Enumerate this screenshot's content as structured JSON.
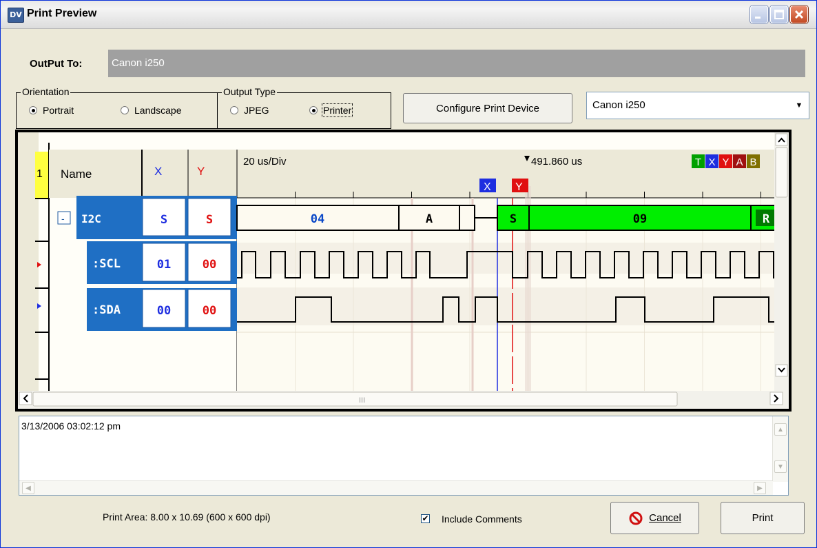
{
  "window": {
    "title": "Print Preview",
    "icon": "app-icon"
  },
  "output": {
    "label": "OutPut To:",
    "value": "Canon i250"
  },
  "orientation": {
    "title": "Orientation",
    "options": [
      {
        "label": "Portrait",
        "selected": true
      },
      {
        "label": "Landscape",
        "selected": false
      }
    ]
  },
  "output_type": {
    "title": "Output Type",
    "options": [
      {
        "label": "JPEG",
        "selected": false
      },
      {
        "label": "Printer",
        "selected": true
      }
    ]
  },
  "configure_button": "Configure Print Device",
  "printer_select": {
    "value": "Canon i250"
  },
  "waveform": {
    "row_number": "1",
    "columns": {
      "name": "Name",
      "x": "X",
      "y": "Y"
    },
    "timebase": "20 us/Div",
    "time_marker": "491.860 us",
    "badges": [
      {
        "label": "T",
        "color": "#00a000"
      },
      {
        "label": "X",
        "color": "#1e2ee0"
      },
      {
        "label": "Y",
        "color": "#e01010"
      },
      {
        "label": "A",
        "color": "#a01010"
      },
      {
        "label": "B",
        "color": "#807000"
      }
    ],
    "cursor_x_label": "X",
    "cursor_y_label": "Y",
    "expand_symbol": "-",
    "channels": [
      {
        "name": "I2C",
        "x": "S",
        "y": "S"
      },
      {
        "name": ":SCL",
        "x": "01",
        "y": "00"
      },
      {
        "name": ":SDA",
        "x": "00",
        "y": "00"
      }
    ],
    "bus_segments": [
      {
        "label": "04",
        "color": "#fdfaf0",
        "text_color": "#0a48c8"
      },
      {
        "label": "A",
        "color": "#fdfaf0",
        "text_color": "#000000"
      },
      {
        "label": "S",
        "color": "#00ee00",
        "text_color": "#000000"
      },
      {
        "label": "09",
        "color": "#00ee00",
        "text_color": "#000000"
      },
      {
        "label": "R",
        "color": "#00ee00",
        "text_color": "#ffffff"
      }
    ],
    "scroll_center": "III"
  },
  "comments": {
    "text": "3/13/2006 03:02:12 pm"
  },
  "print_area": "Print Area: 8.00 x 10.69  (600 x 600 dpi)",
  "include_comments": {
    "label": "Include Comments",
    "checked": true
  },
  "cancel_button": "Cancel",
  "print_button": "Print"
}
